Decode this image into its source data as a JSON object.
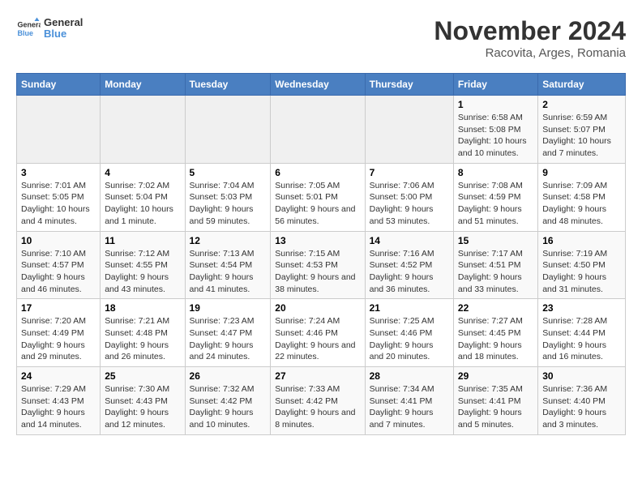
{
  "header": {
    "logo_general": "General",
    "logo_blue": "Blue",
    "title": "November 2024",
    "subtitle": "Racovita, Arges, Romania"
  },
  "days_of_week": [
    "Sunday",
    "Monday",
    "Tuesday",
    "Wednesday",
    "Thursday",
    "Friday",
    "Saturday"
  ],
  "weeks": [
    [
      {
        "day": "",
        "info": ""
      },
      {
        "day": "",
        "info": ""
      },
      {
        "day": "",
        "info": ""
      },
      {
        "day": "",
        "info": ""
      },
      {
        "day": "",
        "info": ""
      },
      {
        "day": "1",
        "info": "Sunrise: 6:58 AM\nSunset: 5:08 PM\nDaylight: 10 hours and 10 minutes."
      },
      {
        "day": "2",
        "info": "Sunrise: 6:59 AM\nSunset: 5:07 PM\nDaylight: 10 hours and 7 minutes."
      }
    ],
    [
      {
        "day": "3",
        "info": "Sunrise: 7:01 AM\nSunset: 5:05 PM\nDaylight: 10 hours and 4 minutes."
      },
      {
        "day": "4",
        "info": "Sunrise: 7:02 AM\nSunset: 5:04 PM\nDaylight: 10 hours and 1 minute."
      },
      {
        "day": "5",
        "info": "Sunrise: 7:04 AM\nSunset: 5:03 PM\nDaylight: 9 hours and 59 minutes."
      },
      {
        "day": "6",
        "info": "Sunrise: 7:05 AM\nSunset: 5:01 PM\nDaylight: 9 hours and 56 minutes."
      },
      {
        "day": "7",
        "info": "Sunrise: 7:06 AM\nSunset: 5:00 PM\nDaylight: 9 hours and 53 minutes."
      },
      {
        "day": "8",
        "info": "Sunrise: 7:08 AM\nSunset: 4:59 PM\nDaylight: 9 hours and 51 minutes."
      },
      {
        "day": "9",
        "info": "Sunrise: 7:09 AM\nSunset: 4:58 PM\nDaylight: 9 hours and 48 minutes."
      }
    ],
    [
      {
        "day": "10",
        "info": "Sunrise: 7:10 AM\nSunset: 4:57 PM\nDaylight: 9 hours and 46 minutes."
      },
      {
        "day": "11",
        "info": "Sunrise: 7:12 AM\nSunset: 4:55 PM\nDaylight: 9 hours and 43 minutes."
      },
      {
        "day": "12",
        "info": "Sunrise: 7:13 AM\nSunset: 4:54 PM\nDaylight: 9 hours and 41 minutes."
      },
      {
        "day": "13",
        "info": "Sunrise: 7:15 AM\nSunset: 4:53 PM\nDaylight: 9 hours and 38 minutes."
      },
      {
        "day": "14",
        "info": "Sunrise: 7:16 AM\nSunset: 4:52 PM\nDaylight: 9 hours and 36 minutes."
      },
      {
        "day": "15",
        "info": "Sunrise: 7:17 AM\nSunset: 4:51 PM\nDaylight: 9 hours and 33 minutes."
      },
      {
        "day": "16",
        "info": "Sunrise: 7:19 AM\nSunset: 4:50 PM\nDaylight: 9 hours and 31 minutes."
      }
    ],
    [
      {
        "day": "17",
        "info": "Sunrise: 7:20 AM\nSunset: 4:49 PM\nDaylight: 9 hours and 29 minutes."
      },
      {
        "day": "18",
        "info": "Sunrise: 7:21 AM\nSunset: 4:48 PM\nDaylight: 9 hours and 26 minutes."
      },
      {
        "day": "19",
        "info": "Sunrise: 7:23 AM\nSunset: 4:47 PM\nDaylight: 9 hours and 24 minutes."
      },
      {
        "day": "20",
        "info": "Sunrise: 7:24 AM\nSunset: 4:46 PM\nDaylight: 9 hours and 22 minutes."
      },
      {
        "day": "21",
        "info": "Sunrise: 7:25 AM\nSunset: 4:46 PM\nDaylight: 9 hours and 20 minutes."
      },
      {
        "day": "22",
        "info": "Sunrise: 7:27 AM\nSunset: 4:45 PM\nDaylight: 9 hours and 18 minutes."
      },
      {
        "day": "23",
        "info": "Sunrise: 7:28 AM\nSunset: 4:44 PM\nDaylight: 9 hours and 16 minutes."
      }
    ],
    [
      {
        "day": "24",
        "info": "Sunrise: 7:29 AM\nSunset: 4:43 PM\nDaylight: 9 hours and 14 minutes."
      },
      {
        "day": "25",
        "info": "Sunrise: 7:30 AM\nSunset: 4:43 PM\nDaylight: 9 hours and 12 minutes."
      },
      {
        "day": "26",
        "info": "Sunrise: 7:32 AM\nSunset: 4:42 PM\nDaylight: 9 hours and 10 minutes."
      },
      {
        "day": "27",
        "info": "Sunrise: 7:33 AM\nSunset: 4:42 PM\nDaylight: 9 hours and 8 minutes."
      },
      {
        "day": "28",
        "info": "Sunrise: 7:34 AM\nSunset: 4:41 PM\nDaylight: 9 hours and 7 minutes."
      },
      {
        "day": "29",
        "info": "Sunrise: 7:35 AM\nSunset: 4:41 PM\nDaylight: 9 hours and 5 minutes."
      },
      {
        "day": "30",
        "info": "Sunrise: 7:36 AM\nSunset: 4:40 PM\nDaylight: 9 hours and 3 minutes."
      }
    ]
  ]
}
